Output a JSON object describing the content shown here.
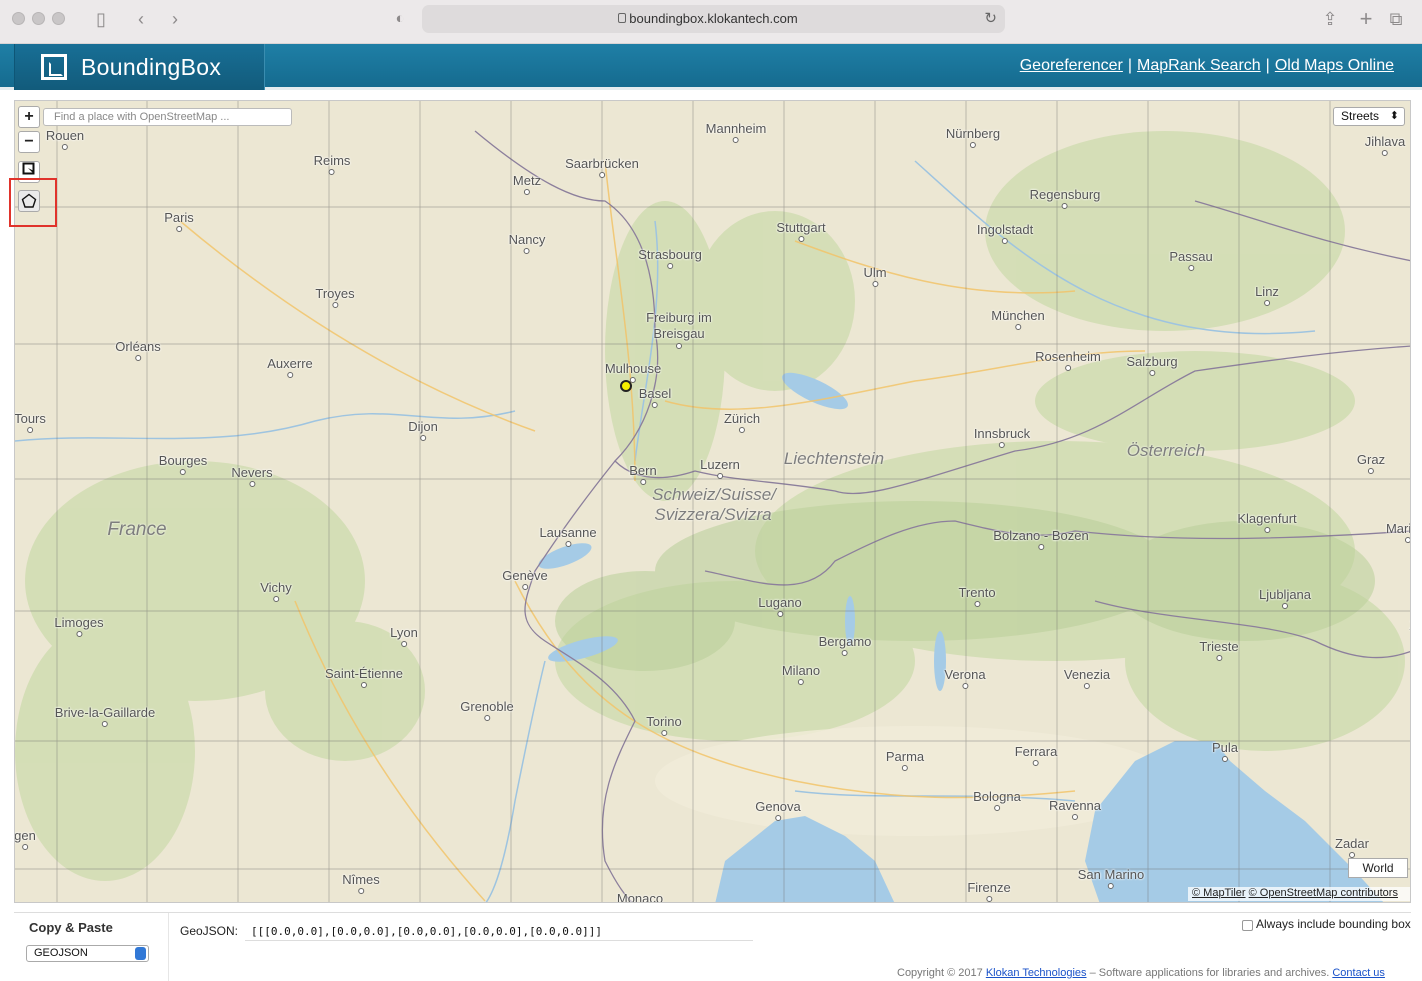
{
  "browser": {
    "url": "boundingbox.klokantech.com"
  },
  "header": {
    "title": "BoundingBox",
    "links": [
      "Georeferencer",
      "MapRank Search",
      "Old Maps Online"
    ]
  },
  "map": {
    "search_placeholder": "Find a place with OpenStreetMap ...",
    "zoom_in": "+",
    "zoom_out": "−",
    "layer": "Streets",
    "world_button": "World",
    "attribution_maptiler": "© MapTiler",
    "attribution_osm": "© OpenStreetMap contributors",
    "cities": [
      "Rouen",
      "Reims",
      "Paris",
      "Metz",
      "Saarbrücken",
      "Mannheim",
      "Nürnberg",
      "Jihlava",
      "Regensburg",
      "Nancy",
      "Strasbourg",
      "Stuttgart",
      "Ingolstadt",
      "Passau",
      "Troyes",
      "Ulm",
      "Linz",
      "Freiburg im Breisgau",
      "München",
      "Orléans",
      "Auxerre",
      "Mulhouse",
      "Basel",
      "Rosenheim",
      "Salzburg",
      "Tours",
      "Dijon",
      "Zürich",
      "Innsbruck",
      "Bourges",
      "Nevers",
      "Luzern",
      "Graz",
      "Bern",
      "Klagenfurt",
      "Maribor",
      "Lausanne",
      "Bolzano - Bozen",
      "Genève",
      "Vichy",
      "Lugano",
      "Trento",
      "Ljubljana",
      "Limoges",
      "Lyon",
      "Bergamo",
      "Trieste",
      "Saint-Étienne",
      "Milano",
      "Verona",
      "Venezia",
      "Brive-la-Gaillarde",
      "Grenoble",
      "Torino",
      "Pula",
      "Parma",
      "Ferrara",
      "Bologna",
      "Genova",
      "Ravenna",
      "Zadar",
      "Nîmes",
      "San Marino",
      "Firenze",
      "Monaco",
      "Za",
      "gen"
    ],
    "countries": [
      "France",
      "Schweiz/Suisse/",
      "Svizzera/Svizra",
      "Liechtenstein",
      "Österreich"
    ]
  },
  "panel": {
    "copy_paste_label": "Copy & Paste",
    "format": "GEOJSON",
    "geojson_label": "GeoJSON:",
    "geojson_value": "[[[0.0,0.0],[0.0,0.0],[0.0,0.0],[0.0,0.0],[0.0,0.0]]]",
    "always_include_label": "Always include bounding box"
  },
  "footer": {
    "copyright": "Copyright © 2017",
    "company": "Klokan Technologies",
    "tagline": "– Software applications for libraries and archives.",
    "contact": "Contact us"
  }
}
